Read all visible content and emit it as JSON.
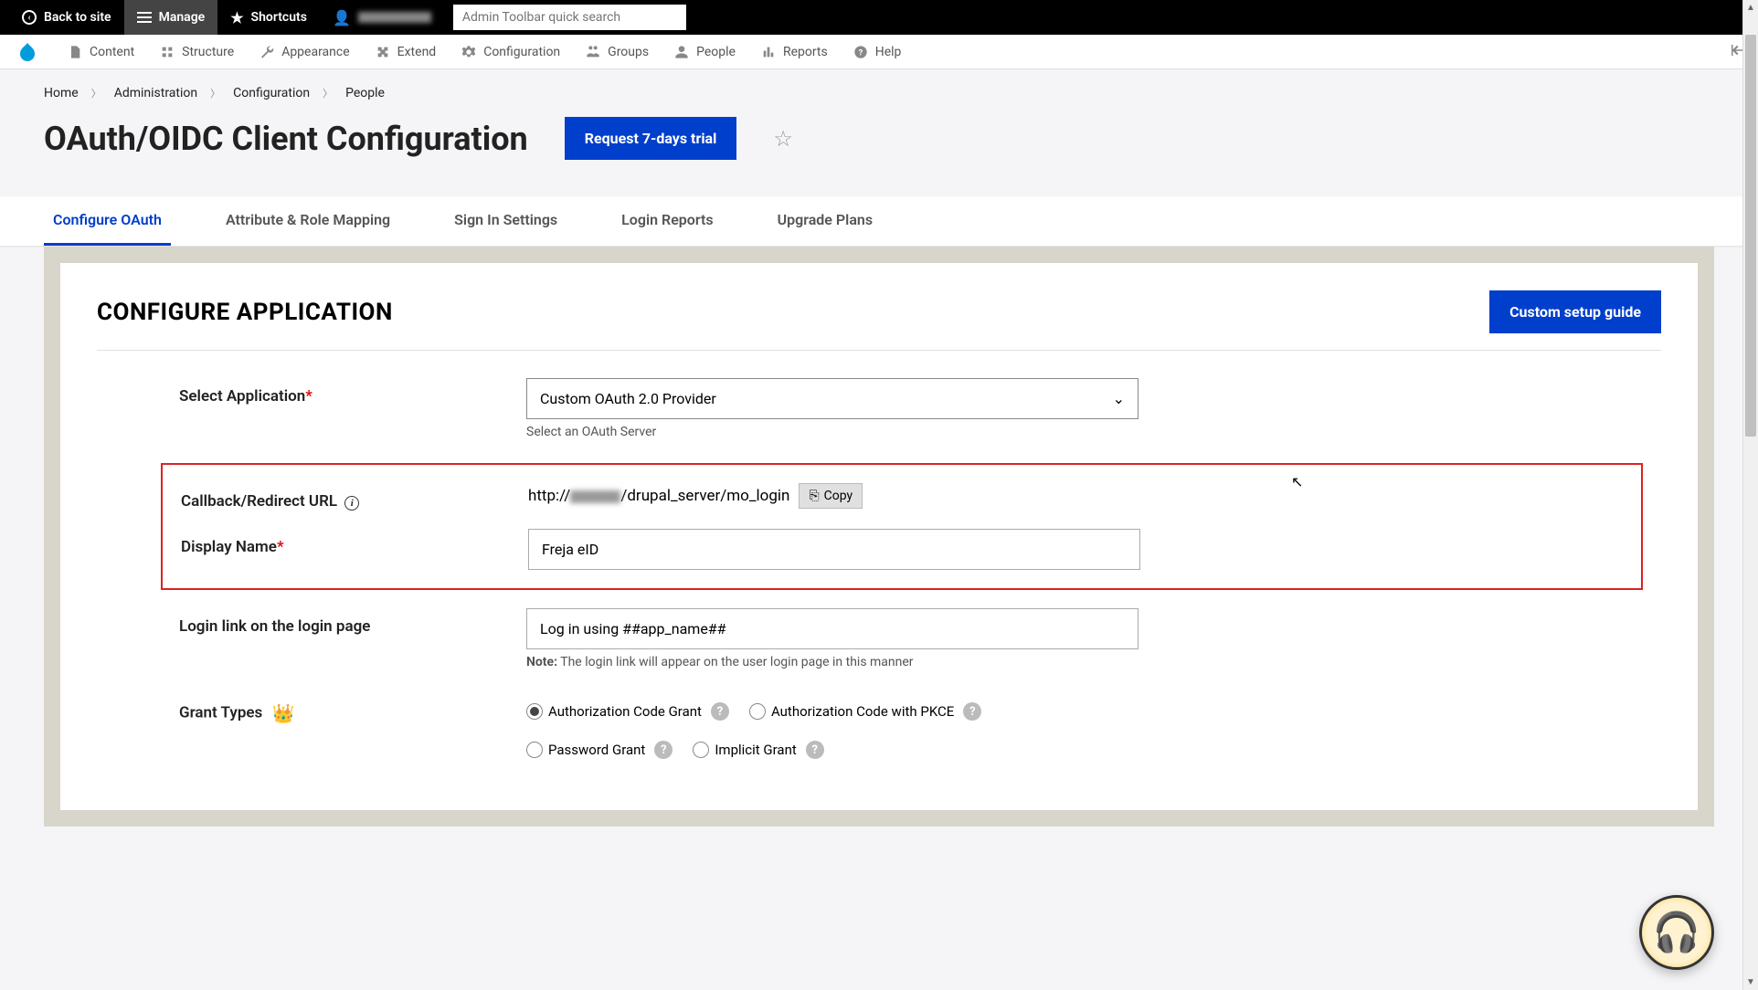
{
  "toolbar": {
    "back_to_site": "Back to site",
    "manage": "Manage",
    "shortcuts": "Shortcuts",
    "search_placeholder": "Admin Toolbar quick search"
  },
  "nav": {
    "items": [
      "Content",
      "Structure",
      "Appearance",
      "Extend",
      "Configuration",
      "Groups",
      "People",
      "Reports",
      "Help"
    ]
  },
  "breadcrumb": [
    "Home",
    "Administration",
    "Configuration",
    "People"
  ],
  "page": {
    "title": "OAuth/OIDC Client Configuration",
    "trial_button": "Request 7-days trial"
  },
  "tabs": [
    "Configure OAuth",
    "Attribute & Role Mapping",
    "Sign In Settings",
    "Login Reports",
    "Upgrade Plans"
  ],
  "panel": {
    "title": "CONFIGURE APPLICATION",
    "guide_button": "Custom setup guide"
  },
  "form": {
    "select_app_label": "Select Application",
    "select_app_value": "Custom OAuth 2.0 Provider",
    "select_app_help": "Select an OAuth Server",
    "callback_label": "Callback/Redirect URL",
    "callback_prefix": "http://",
    "callback_suffix": "/drupal_server/mo_login",
    "copy_button": "Copy",
    "display_name_label": "Display Name",
    "display_name_value": "Freja eID",
    "login_link_label": "Login link on the login page",
    "login_link_value": "Log in using ##app_name##",
    "login_link_note_label": "Note:",
    "login_link_note": "The login link will appear on the user login page in this manner",
    "grant_types_label": "Grant Types",
    "grant_types": [
      {
        "label": "Authorization Code Grant",
        "checked": true
      },
      {
        "label": "Authorization Code with PKCE",
        "checked": false
      },
      {
        "label": "Password Grant",
        "checked": false
      },
      {
        "label": "Implicit Grant",
        "checked": false
      }
    ]
  }
}
